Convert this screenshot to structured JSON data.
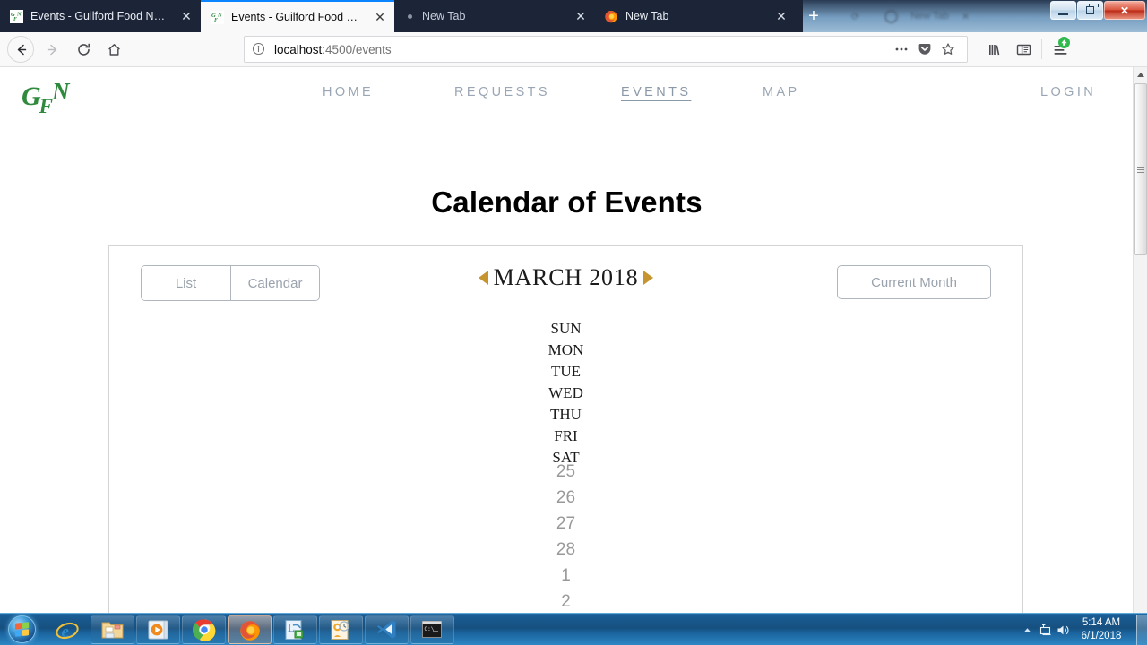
{
  "browser": {
    "tabs": [
      {
        "title": "Events - Guilford Food Network",
        "favicon": "gfn-logo-icon",
        "state": "inactive",
        "close_label": "✕"
      },
      {
        "title": "Events - Guilford Food Network",
        "favicon": "gfn-logo-icon",
        "state": "active",
        "close_label": "✕"
      },
      {
        "title": "New Tab",
        "favicon": "dot-icon",
        "state": "inactive",
        "close_label": "✕"
      },
      {
        "title": "New Tab",
        "favicon": "firefox-icon",
        "state": "inactive",
        "close_label": "✕"
      }
    ],
    "new_tab_label": "+",
    "url": {
      "host": "localhost",
      "path": ":4500/events"
    },
    "toolbar": {
      "back_label": "←",
      "forward_label": "→",
      "reload_label": "↻",
      "home_label": "⌂",
      "page_actions_label": "…",
      "pocket_label": "pocket-icon",
      "bookmark_label": "☆",
      "library_label": "library-icon",
      "sidebar_label": "sidebar-icon",
      "menu_label": "hamburger-menu-icon"
    },
    "window_controls": {
      "minimize": "–",
      "restore": "❐",
      "close": "✕"
    },
    "background_window": {
      "tab_title": "New Tab",
      "close_label": "✕"
    }
  },
  "site": {
    "logo": {
      "g": "G",
      "f": "F",
      "n": "N",
      "color": "#2f8a3e"
    },
    "nav": [
      {
        "label": "HOME",
        "active": false
      },
      {
        "label": "REQUESTS",
        "active": false
      },
      {
        "label": "EVENTS",
        "active": true
      },
      {
        "label": "MAP",
        "active": false
      },
      {
        "label": "LOGIN",
        "active": false
      }
    ],
    "page_title": "Calendar of Events"
  },
  "calendar": {
    "view_buttons": [
      {
        "label": "List",
        "selected": false
      },
      {
        "label": "Calendar",
        "selected": false
      }
    ],
    "prev_label": "◀",
    "next_label": "▶",
    "month_label": "MARCH 2018",
    "current_month_button": "Current Month",
    "arrow_color": "#c6952f",
    "day_names": [
      "SUN",
      "MON",
      "TUE",
      "WED",
      "THU",
      "FRI",
      "SAT"
    ],
    "day_numbers": [
      "25",
      "26",
      "27",
      "28",
      "1",
      "2"
    ]
  },
  "taskbar": {
    "start_label": "start-orb-icon",
    "items": [
      {
        "name": "internet-explorer",
        "label": "Internet Explorer"
      },
      {
        "name": "windows-explorer",
        "label": "Windows Explorer"
      },
      {
        "name": "windows-media-player",
        "label": "Windows Media Player"
      },
      {
        "name": "google-chrome",
        "label": "Google Chrome"
      },
      {
        "name": "firefox",
        "label": "Mozilla Firefox"
      },
      {
        "name": "lync",
        "label": "Skype for Business"
      },
      {
        "name": "outlook",
        "label": "Microsoft Outlook"
      },
      {
        "name": "vscode",
        "label": "Visual Studio Code"
      },
      {
        "name": "command-prompt",
        "label": "Command Prompt"
      }
    ],
    "tray": {
      "show_hidden": "▲",
      "network": "network-icon",
      "volume": "volume-icon"
    },
    "clock": {
      "time": "5:14 AM",
      "date": "6/1/2018"
    }
  }
}
